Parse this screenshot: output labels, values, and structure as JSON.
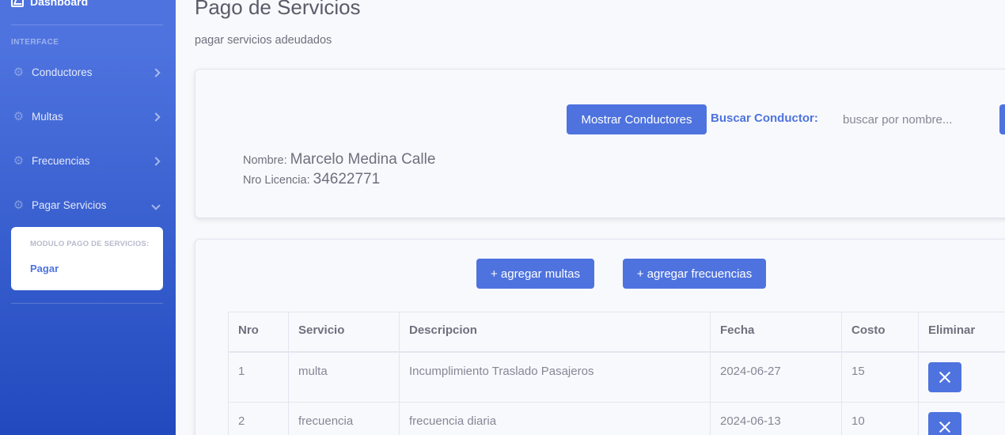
{
  "sidebar": {
    "brand": "Dashboard",
    "heading": "INTERFACE",
    "items": [
      {
        "label": "Conductores"
      },
      {
        "label": "Multas"
      },
      {
        "label": "Frecuencias"
      },
      {
        "label": "Pagar Servicios"
      }
    ],
    "submenu": {
      "heading": "MODULO PAGO DE SERVICIOS:",
      "item": "Pagar"
    }
  },
  "page": {
    "title": "Pago de Servicios",
    "subtitle": "pagar servicios adeudados"
  },
  "search_card": {
    "show_button": "Mostrar Conductores",
    "search_label": "Buscar Conductor:",
    "search_placeholder": "buscar por nombre...",
    "name_label": "Nombre:",
    "name_value": "Marcelo Medina Calle",
    "license_label": "Nro Licencia:",
    "license_value": "34622771"
  },
  "services_card": {
    "add_multas": "+ agregar multas",
    "add_frecuencias": "+ agregar frecuencias",
    "columns": [
      "Nro",
      "Servicio",
      "Descripcion",
      "Fecha",
      "Costo",
      "Eliminar"
    ],
    "rows": [
      {
        "nro": "1",
        "servicio": "multa",
        "descripcion": "Incumplimiento Traslado Pasajeros",
        "fecha": "2024-06-27",
        "costo": "15"
      },
      {
        "nro": "2",
        "servicio": "frecuencia",
        "descripcion": "frecuencia diaria",
        "fecha": "2024-06-13",
        "costo": "10"
      }
    ]
  },
  "colors": {
    "primary": "#4e73df",
    "sidebar_gradient_end": "#224abe",
    "background": "#f8f9fc"
  }
}
